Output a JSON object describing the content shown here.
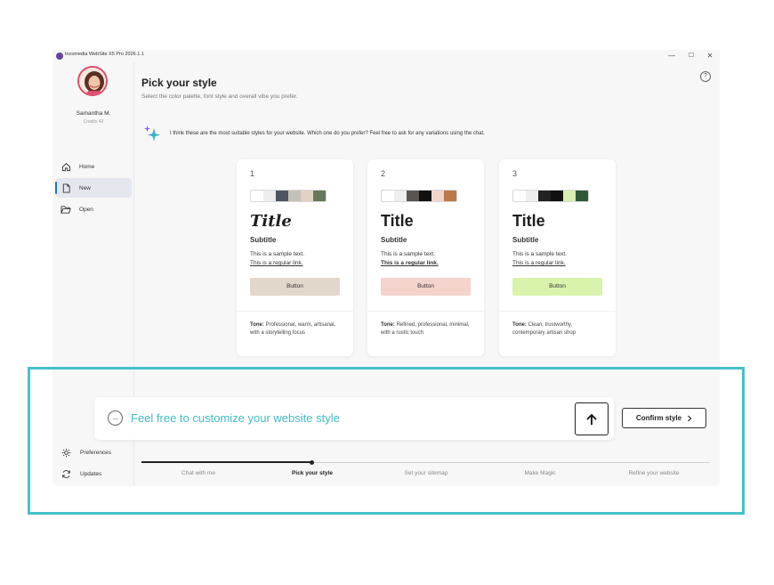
{
  "window": {
    "title": "Incomedia WebSite X5 Pro 2026.1.1",
    "controls": {
      "minimize": "—",
      "maximize": "☐",
      "close": "✕"
    }
  },
  "user": {
    "name": "Samantha M.",
    "credits": "Credits 42"
  },
  "sidebar": {
    "items": [
      {
        "label": "Home",
        "icon": "home-icon"
      },
      {
        "label": "New",
        "icon": "new-file-icon",
        "active": true
      },
      {
        "label": "Open",
        "icon": "folder-open-icon"
      }
    ],
    "bottom": [
      {
        "label": "Preferences",
        "icon": "gear-icon"
      },
      {
        "label": "Updates",
        "icon": "refresh-icon"
      }
    ]
  },
  "main": {
    "title": "Pick your style",
    "subtitle": "Select the color palette, font style and overall vibe you prefer.",
    "help": "?",
    "ai_message": "I think these are the most suitable styles for your website. Which one do you prefer? Feel free to ask for any variations using the chat."
  },
  "cards": [
    {
      "number": "1",
      "palette": [
        "#ffffff",
        "#eeeeee",
        "#4e5560",
        "#c3c0bb",
        "#e2d2c4",
        "#66785a"
      ],
      "title": "Title",
      "subtitle": "Subtitle",
      "sample": "This is a sample text.",
      "link": "This is a regular link.",
      "button": "Button",
      "button_color": "#e2d7cb",
      "tone_label": "Tone:",
      "tone": "Professional, warm, artisanal, with a storytelling focus"
    },
    {
      "number": "2",
      "palette": [
        "#ffffff",
        "#eeeeee",
        "#5a5550",
        "#111111",
        "#f1d4cc",
        "#b87a48"
      ],
      "title": "Title",
      "subtitle": "Subtitle",
      "sample": "This is a sample text.",
      "link": "This is a regular link.",
      "button": "Button",
      "button_color": "#f3d3cc",
      "tone_label": "Tone:",
      "tone": "Refined, professional, minimal, with a rustic touch"
    },
    {
      "number": "3",
      "palette": [
        "#ffffff",
        "#eeeeee",
        "#222222",
        "#111111",
        "#d7f0b2",
        "#2f5a3a"
      ],
      "title": "Title",
      "subtitle": "Subtitle",
      "sample": "This is a sample text.",
      "link": "This is a regular link.",
      "button": "Button",
      "button_color": "#d9f3ad",
      "tone_label": "Tone:",
      "tone": "Clean, trustworthy, contemporary artisan shop"
    }
  ],
  "chat": {
    "placeholder": "Feel free to customize your website style",
    "send_icon": "arrow-up-icon"
  },
  "confirm": {
    "label": "Confirm style",
    "icon": "chevron-right-icon"
  },
  "progress": {
    "steps": [
      "Chat with me",
      "Pick your style",
      "Set your sitemap",
      "Make Magic",
      "Refine your website"
    ],
    "current": 1,
    "fraction": 0.3
  },
  "colors": {
    "accent": "#46c1cb",
    "primary_dark": "#222222",
    "active_nav": "#1a73d9"
  }
}
